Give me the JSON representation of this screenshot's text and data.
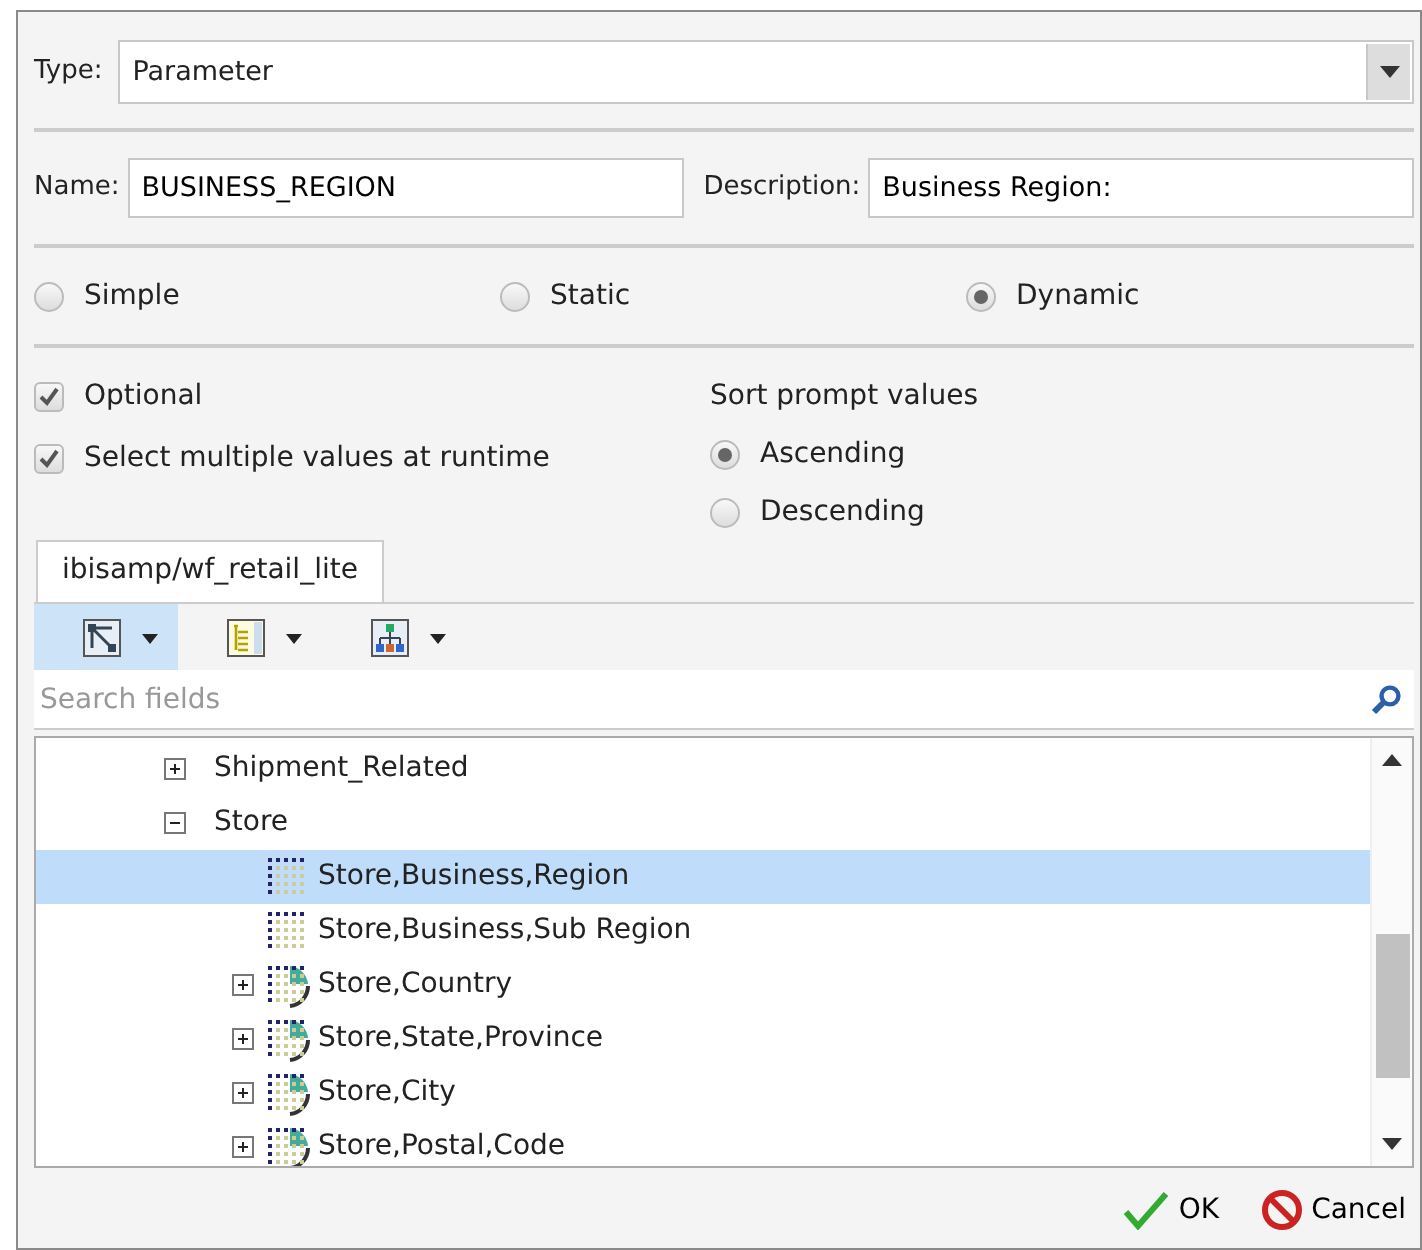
{
  "type_field": {
    "label": "Type:",
    "value": "Parameter"
  },
  "name_field": {
    "label": "Name:",
    "value": "BUSINESS_REGION"
  },
  "description_field": {
    "label": "Description:",
    "value": "Business Region:"
  },
  "mode_options": [
    {
      "label": "Simple",
      "selected": false
    },
    {
      "label": "Static",
      "selected": false
    },
    {
      "label": "Dynamic",
      "selected": true
    }
  ],
  "options": [
    {
      "label": "Optional",
      "checked": true
    },
    {
      "label": "Select multiple values at runtime",
      "checked": true
    }
  ],
  "sort": {
    "title": "Sort prompt values",
    "options": [
      {
        "label": "Ascending",
        "selected": true
      },
      {
        "label": "Descending",
        "selected": false
      }
    ]
  },
  "tabs": [
    {
      "label": "ibisamp/wf_retail_lite",
      "selected": true
    }
  ],
  "toolbar": [
    {
      "kind": "network",
      "selected": true
    },
    {
      "kind": "list",
      "selected": false
    },
    {
      "kind": "hierarchy",
      "selected": false
    }
  ],
  "search": {
    "placeholder": "Search fields"
  },
  "tree": [
    {
      "label": "Shipment_Related",
      "expanded": false,
      "selected": false
    },
    {
      "label": "Store",
      "expanded": true,
      "selected": false,
      "children": [
        {
          "label": "Store,Business,Region",
          "kind": "level",
          "selected": true
        },
        {
          "label": "Store,Business,Sub Region",
          "kind": "level",
          "selected": false
        },
        {
          "label": "Store,Country",
          "kind": "dimension",
          "expanded": false,
          "selected": false
        },
        {
          "label": "Store,State,Province",
          "kind": "dimension",
          "expanded": false,
          "selected": false
        },
        {
          "label": "Store,City",
          "kind": "dimension",
          "expanded": false,
          "selected": false
        },
        {
          "label": "Store,Postal,Code",
          "kind": "dimension",
          "expanded": false,
          "selected": false
        }
      ]
    }
  ],
  "buttons": [
    {
      "kind": "ok",
      "label": "OK"
    },
    {
      "kind": "cancel",
      "label": "Cancel"
    }
  ]
}
